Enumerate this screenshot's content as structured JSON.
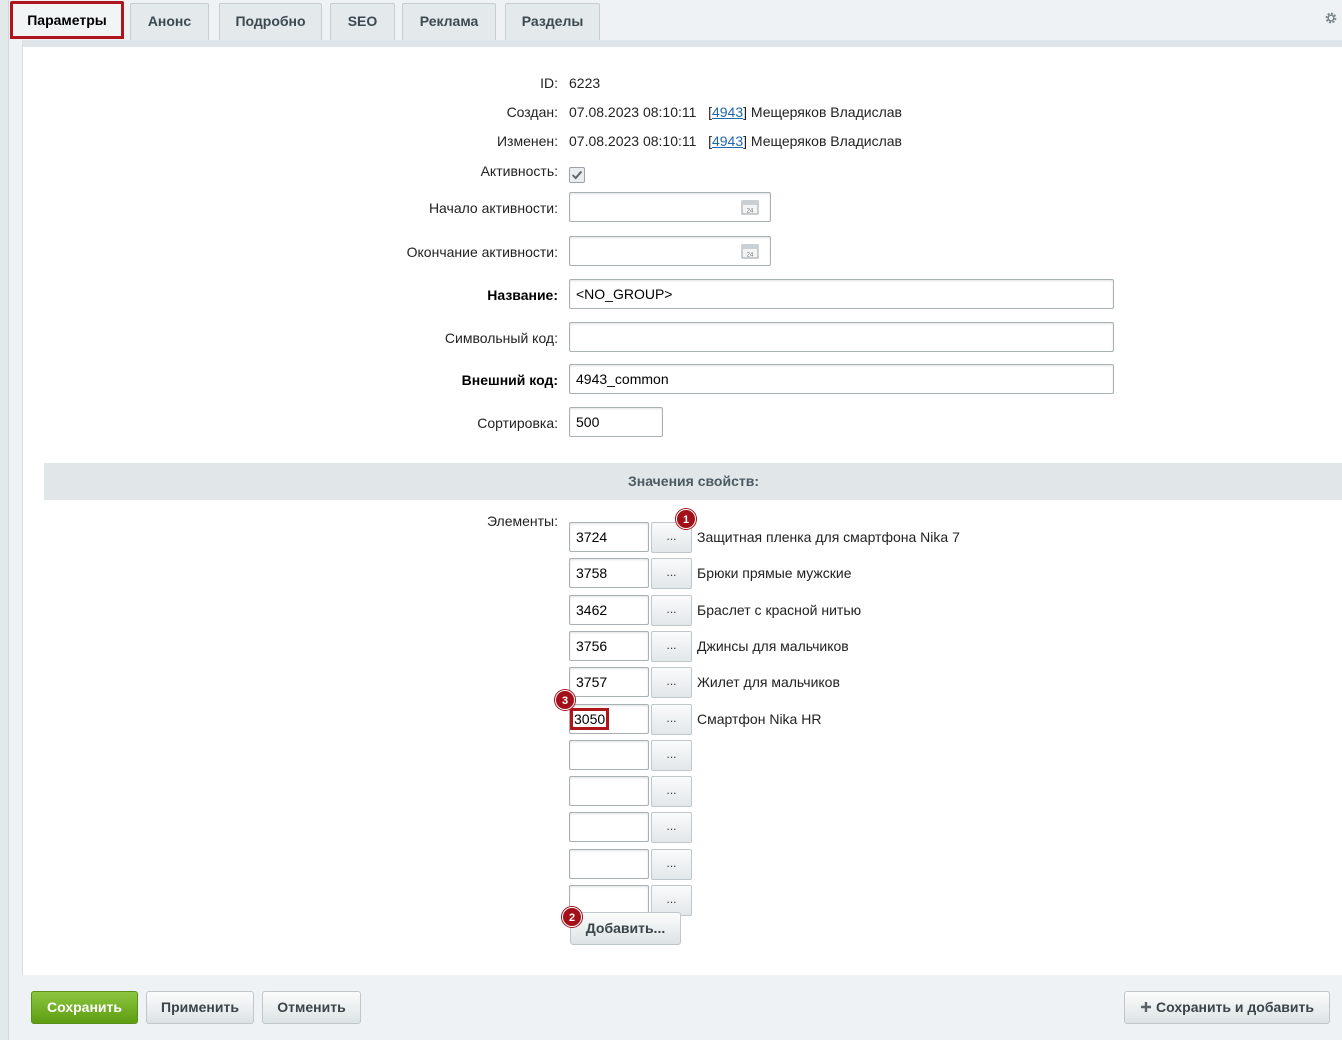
{
  "tabs": [
    {
      "label": "Параметры"
    },
    {
      "label": "Анонс"
    },
    {
      "label": "Подробно"
    },
    {
      "label": "SEO"
    },
    {
      "label": "Реклама"
    },
    {
      "label": "Разделы"
    }
  ],
  "fields": {
    "id_label": "ID:",
    "id_value": "6223",
    "created_label": "Создан:",
    "created_date": "07.08.2023 08:10:11",
    "created_user_id": "4943",
    "created_user_name": "Мещеряков Владислав",
    "modified_label": "Изменен:",
    "modified_date": "07.08.2023 08:10:11",
    "modified_user_id": "4943",
    "modified_user_name": "Мещеряков Владислав",
    "active_label": "Активность:",
    "active_checked": true,
    "active_from_label": "Начало активности:",
    "active_from_value": "",
    "active_to_label": "Окончание активности:",
    "active_to_value": "",
    "name_label": "Название:",
    "name_value": "<NO_GROUP>",
    "code_label": "Символьный код:",
    "code_value": "",
    "xml_id_label": "Внешний код:",
    "xml_id_value": "4943_common",
    "sort_label": "Сортировка:",
    "sort_value": "500"
  },
  "properties": {
    "section_title": "Значения свойств:",
    "elements_label": "Элементы:",
    "browse_label": "...",
    "add_label": "Добавить...",
    "items": [
      {
        "value": "3724",
        "name": "Защитная пленка для смартфона Nika 7"
      },
      {
        "value": "3758",
        "name": "Брюки прямые мужские"
      },
      {
        "value": "3462",
        "name": "Браслет с красной нитью"
      },
      {
        "value": "3756",
        "name": "Джинсы для мальчиков"
      },
      {
        "value": "3757",
        "name": "Жилет для мальчиков"
      },
      {
        "value": "3050",
        "name": "Смартфон Nika HR"
      },
      {
        "value": "",
        "name": ""
      },
      {
        "value": "",
        "name": ""
      },
      {
        "value": "",
        "name": ""
      },
      {
        "value": "",
        "name": ""
      },
      {
        "value": "",
        "name": ""
      }
    ]
  },
  "badges": {
    "one": "1",
    "two": "2",
    "three": "3"
  },
  "footer": {
    "save": "Сохранить",
    "apply": "Применить",
    "cancel": "Отменить",
    "save_and_add": "Сохранить и добавить"
  },
  "icons": [
    "gear-icon",
    "calendar-icon",
    "checkbox-icon",
    "plus-icon"
  ],
  "colors": {
    "accent_green": "#6aad1c",
    "highlight_red": "#b0141c",
    "link_blue": "#2067b0"
  }
}
